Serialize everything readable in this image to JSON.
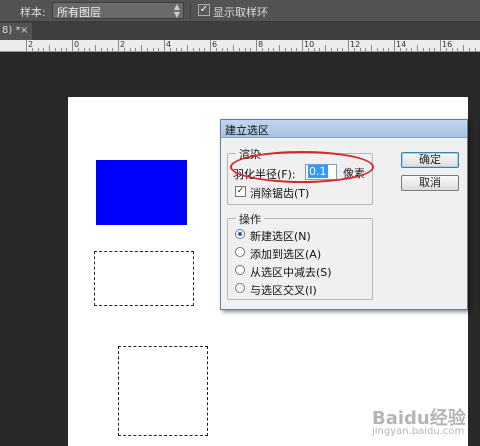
{
  "options_bar": {
    "sample_label": "样本:",
    "sample_value": "所有图层",
    "show_ring_checked": true,
    "show_ring_label": "显示取样环"
  },
  "document_tab": {
    "label": "8) *",
    "close": "×"
  },
  "ruler": {
    "labels": [
      "2",
      "0",
      "2",
      "4",
      "6",
      "8",
      "10",
      "12",
      "14",
      "16",
      "18"
    ]
  },
  "dialog": {
    "title": "建立选区",
    "render_group": {
      "title": "渲染",
      "feather_label": "羽化半径(F):",
      "feather_value": "0.1",
      "feather_unit": "像素",
      "antialias_checked": true,
      "antialias_label": "消除锯齿(T)"
    },
    "operation_group": {
      "title": "操作",
      "options": [
        {
          "label": "新建选区(N)",
          "selected": true
        },
        {
          "label": "添加到选区(A)",
          "selected": false
        },
        {
          "label": "从选区中减去(S)",
          "selected": false
        },
        {
          "label": "与选区交叉(I)",
          "selected": false
        }
      ]
    },
    "ok_label": "确定",
    "cancel_label": "取消"
  },
  "watermark": {
    "text": "Baidu经验",
    "sub": "jingyan.baidu.com"
  },
  "colors": {
    "shape_fill": "#0000ff",
    "highlight_oval": "#d8262c",
    "workspace_bg": "#282828"
  }
}
